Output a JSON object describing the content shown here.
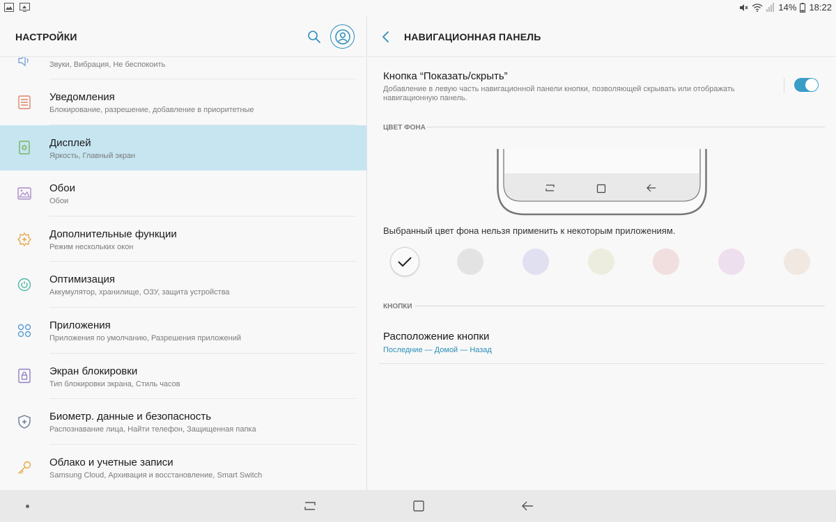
{
  "status_bar": {
    "battery": "14%",
    "time": "18:22",
    "icons": [
      "image-icon",
      "cast-icon",
      "mute-icon",
      "wifi-icon",
      "signal-icon",
      "battery-icon"
    ]
  },
  "left": {
    "title": "НАСТРОЙКИ",
    "items": [
      {
        "icon": "sound-icon",
        "title": "",
        "subtitle": "Звуки, Вибрация, Не беспокоить"
      },
      {
        "icon": "notifications-icon",
        "title": "Уведомления",
        "subtitle": "Блокирование, разрешение, добавление в приоритетные"
      },
      {
        "icon": "display-icon",
        "title": "Дисплей",
        "subtitle": "Яркость, Главный экран"
      },
      {
        "icon": "wallpaper-icon",
        "title": "Обои",
        "subtitle": "Обои"
      },
      {
        "icon": "advanced-features-icon",
        "title": "Дополнительные функции",
        "subtitle": "Режим нескольких окон"
      },
      {
        "icon": "optimization-icon",
        "title": "Оптимизация",
        "subtitle": "Аккумулятор, хранилище, ОЗУ, защита устройства"
      },
      {
        "icon": "apps-icon",
        "title": "Приложения",
        "subtitle": "Приложения по умолчанию, Разрешения приложений"
      },
      {
        "icon": "lock-screen-icon",
        "title": "Экран блокировки",
        "subtitle": "Тип блокировки экрана, Стиль часов"
      },
      {
        "icon": "shield-icon",
        "title": "Биометр. данные и безопасность",
        "subtitle": "Распознавание лица, Найти телефон, Защищенная папка"
      },
      {
        "icon": "key-icon",
        "title": "Облако и учетные записи",
        "subtitle": "Samsung Cloud, Архивация и восстановление, Smart Switch"
      }
    ]
  },
  "right": {
    "title": "НАВИГАЦИОННАЯ ПАНЕЛЬ",
    "toggle": {
      "title": "Кнопка “Показать/скрыть”",
      "description": "Добавление в левую часть навигационной панели кнопки, позволяющей скрывать или отображать навигационную панель.",
      "enabled": true
    },
    "bg_section": "ЦВЕТ ФОНА",
    "color_note": "Выбранный цвет фона нельзя применить к некоторым приложениям.",
    "colors": [
      "#fafafa",
      "#e3e3e3",
      "#e0e0f0",
      "#ededdf",
      "#f1dede",
      "#eedfee",
      "#f1e8e2"
    ],
    "buttons_section": "КНОПКИ",
    "button_layout": {
      "title": "Расположение кнопки",
      "value": "Последние — Домой — Назад"
    }
  },
  "accent": "#2b8eb8",
  "active_highlight": "#c6e5f1"
}
